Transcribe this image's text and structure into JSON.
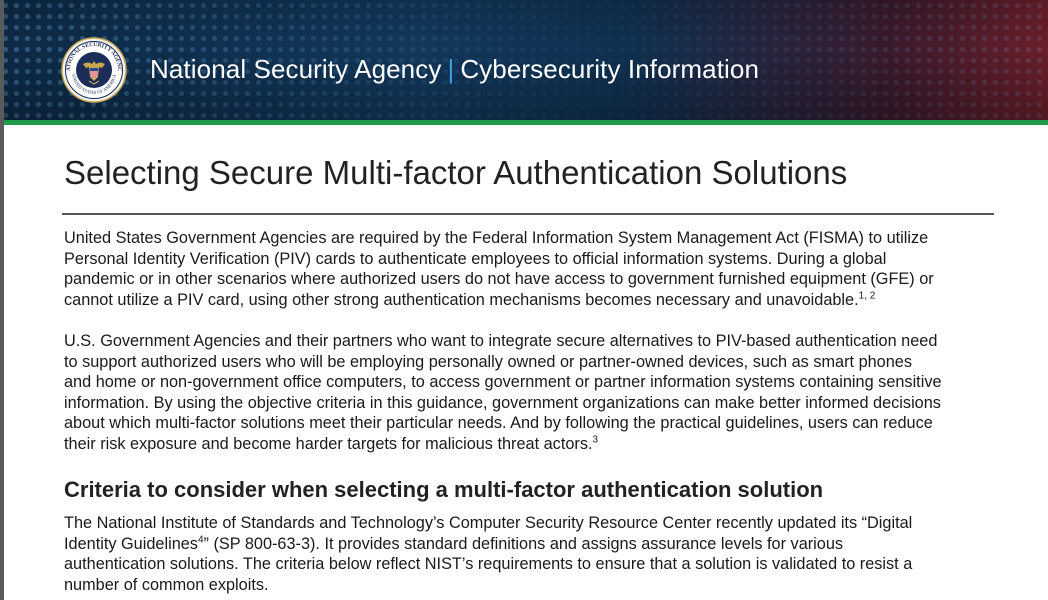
{
  "header": {
    "agency": "National Security Agency",
    "separator": "|",
    "section": "Cybersecurity Information",
    "seal_icon": "nsa-seal-icon",
    "seal_top_text": "NATIONAL SECURITY AGENCY",
    "seal_bottom_text": "UNITED STATES OF AMERICA"
  },
  "document": {
    "title": "Selecting Secure Multi-factor Authentication Solutions",
    "paragraph1": {
      "lines": [
        "United States Government Agencies are required by the Federal Information System Management Act (FISMA) to utilize",
        "Personal Identity Verification (PIV) cards to authenticate employees to official information systems. During a global",
        "pandemic or in other scenarios where authorized users do not have access to government furnished equipment (GFE) or",
        "cannot utilize a PIV card, using other strong authentication mechanisms becomes necessary and unavoidable."
      ],
      "footnote": "1, 2"
    },
    "paragraph2": {
      "lines": [
        "U.S. Government Agencies and their partners who want to integrate secure alternatives to PIV-based authentication need",
        "to support authorized users who will be employing personally owned or partner-owned devices, such as smart phones",
        "and home or non-government office computers, to access government or partner information systems containing sensitive",
        "information. By using the objective criteria in this guidance, government organizations can make better informed decisions",
        "about which multi-factor solutions meet their particular needs. And by following the practical guidelines, users can reduce",
        "their risk exposure and become harder targets for malicious threat actors."
      ],
      "footnote": "3"
    },
    "section_heading": "Criteria to consider when selecting a multi-factor authentication solution",
    "paragraph3": {
      "line1_before": "The National Institute of Standards and Technology’s Computer Security Resource Center recently updated its “Digital",
      "line2_before": "Identity Guidelines",
      "line2_footnote": "4",
      "line2_after": "” (SP 800-63-3). It provides standard definitions and assigns assurance levels for various",
      "line3": "authentication solutions. The criteria below reflect NIST’s requirements to ensure that a solution is validated to resist a",
      "line4": "number of common exploits."
    }
  },
  "colors": {
    "banner_dark": "#0d2a47",
    "banner_accent_red": "#6b1f2a",
    "separator_blue": "#3ea0e0",
    "rule_green": "#1f9a4a"
  }
}
